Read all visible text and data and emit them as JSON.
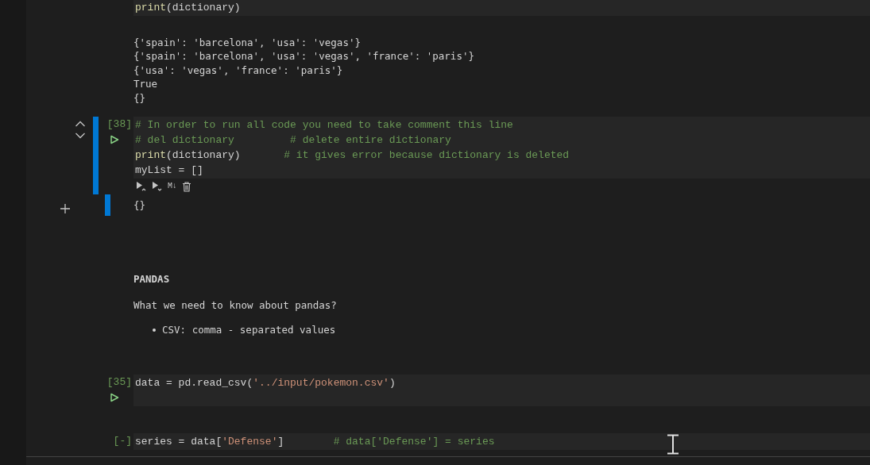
{
  "cells": [
    {
      "kind": "code",
      "focused": false,
      "run_icon": false,
      "lines": [
        [
          {
            "kind": "func",
            "s": "print"
          },
          {
            "kind": "plain",
            "s": "(dictionary)"
          }
        ]
      ]
    },
    {
      "kind": "output",
      "focused": false,
      "lines": [
        "{'spain': 'barcelona', 'usa': 'vegas'}",
        "{'spain': 'barcelona', 'usa': 'vegas', 'france': 'paris'}",
        "{'usa': 'vegas', 'france': 'paris'}",
        "True",
        "{}"
      ]
    },
    {
      "kind": "code",
      "count": "[38]",
      "focused": true,
      "run_icon": true,
      "lines": [
        [
          {
            "kind": "comment",
            "s": "# In order to run all code you need to take comment this line"
          }
        ],
        [
          {
            "kind": "comment",
            "s": "# del dictionary         # delete entire dictionary"
          }
        ],
        [
          {
            "kind": "func",
            "s": "print"
          },
          {
            "kind": "plain",
            "s": "(dictionary)       "
          },
          {
            "kind": "comment",
            "s": "# it gives error because dictionary is deleted"
          }
        ],
        [
          {
            "kind": "plain",
            "s": "myList = []"
          }
        ]
      ],
      "toolbar": [
        {
          "kind": "run-above"
        },
        {
          "kind": "run-below"
        },
        {
          "kind": "markdown",
          "label": "M↓"
        },
        {
          "kind": "delete"
        }
      ]
    },
    {
      "kind": "output",
      "focused": true,
      "lines": [
        "{}"
      ]
    },
    {
      "kind": "markdown",
      "heading": "PANDAS",
      "paragraph": "What we need to know about pandas?",
      "bullets": [
        "CSV: comma - separated values"
      ]
    },
    {
      "kind": "code",
      "count": "[35]",
      "focused": false,
      "run_icon": true,
      "lines": [
        [
          {
            "kind": "plain",
            "s": "data = pd.read_csv("
          },
          {
            "kind": "string",
            "s": "'../input/pokemon.csv'"
          },
          {
            "kind": "plain",
            "s": ")"
          }
        ]
      ]
    },
    {
      "kind": "code",
      "count": "[-]",
      "focused": false,
      "run_icon": false,
      "lines": [
        [
          {
            "kind": "plain",
            "s": "series = data["
          },
          {
            "kind": "string",
            "s": "'Defense'"
          },
          {
            "kind": "plain",
            "s": "]        "
          },
          {
            "kind": "comment",
            "s": "# data['Defense'] = series"
          }
        ]
      ]
    }
  ]
}
